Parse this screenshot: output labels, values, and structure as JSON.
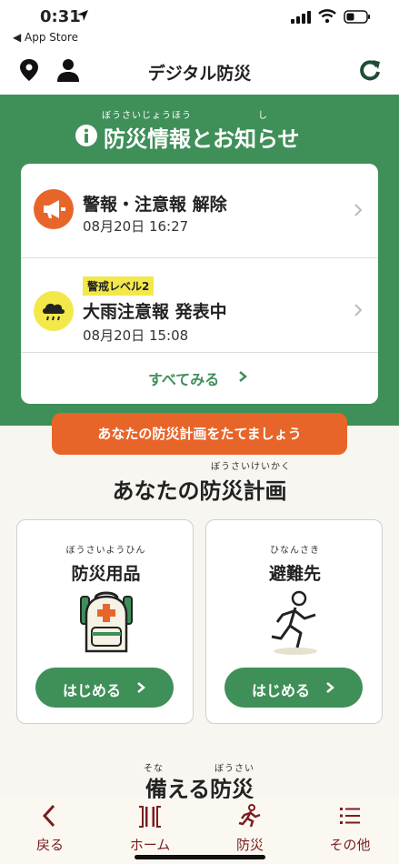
{
  "status_bar": {
    "time": "0:31",
    "back_app": "◀ App Store"
  },
  "header": {
    "title": "デジタル防災"
  },
  "info_section": {
    "ruby_main": "ぼうさいじょうほう",
    "ruby_shi": "し",
    "title": "防災情報とお知らせ",
    "items": [
      {
        "title": "警報・注意報 解除",
        "date": "08月20日 16:27",
        "icon": "megaphone-icon"
      },
      {
        "badge": "警戒レベル2",
        "title": "大雨注意報 発表中",
        "date": "08月20日 15:08",
        "icon": "rain-cloud-icon"
      }
    ],
    "see_all": "すべてみる"
  },
  "plan_section": {
    "banner": "あなたの防災計画をたてましょう",
    "ruby": "ぼうさいけいかく",
    "title": "あなたの防災計画",
    "cards": [
      {
        "ruby": "ぼうさいようひん",
        "title": "防災用品",
        "button": "はじめる",
        "icon": "emergency-backpack-icon"
      },
      {
        "ruby": "ひなんさき",
        "title": "避難先",
        "button": "はじめる",
        "icon": "running-person-icon"
      }
    ]
  },
  "prep_section": {
    "ruby1": "そな",
    "ruby2": "ぼうさい",
    "title": "備える防災"
  },
  "tabbar": {
    "tabs": [
      {
        "label": "戻る",
        "icon": "back-chevron-icon"
      },
      {
        "label": "ホーム",
        "icon": "home-icon"
      },
      {
        "label": "防災",
        "icon": "disaster-prevention-icon"
      },
      {
        "label": "その他",
        "icon": "menu-list-icon"
      }
    ]
  },
  "colors": {
    "green": "#3f8f58",
    "orange": "#e8652a",
    "yellow": "#f3e84a",
    "tab_text": "#7a1d1d"
  }
}
